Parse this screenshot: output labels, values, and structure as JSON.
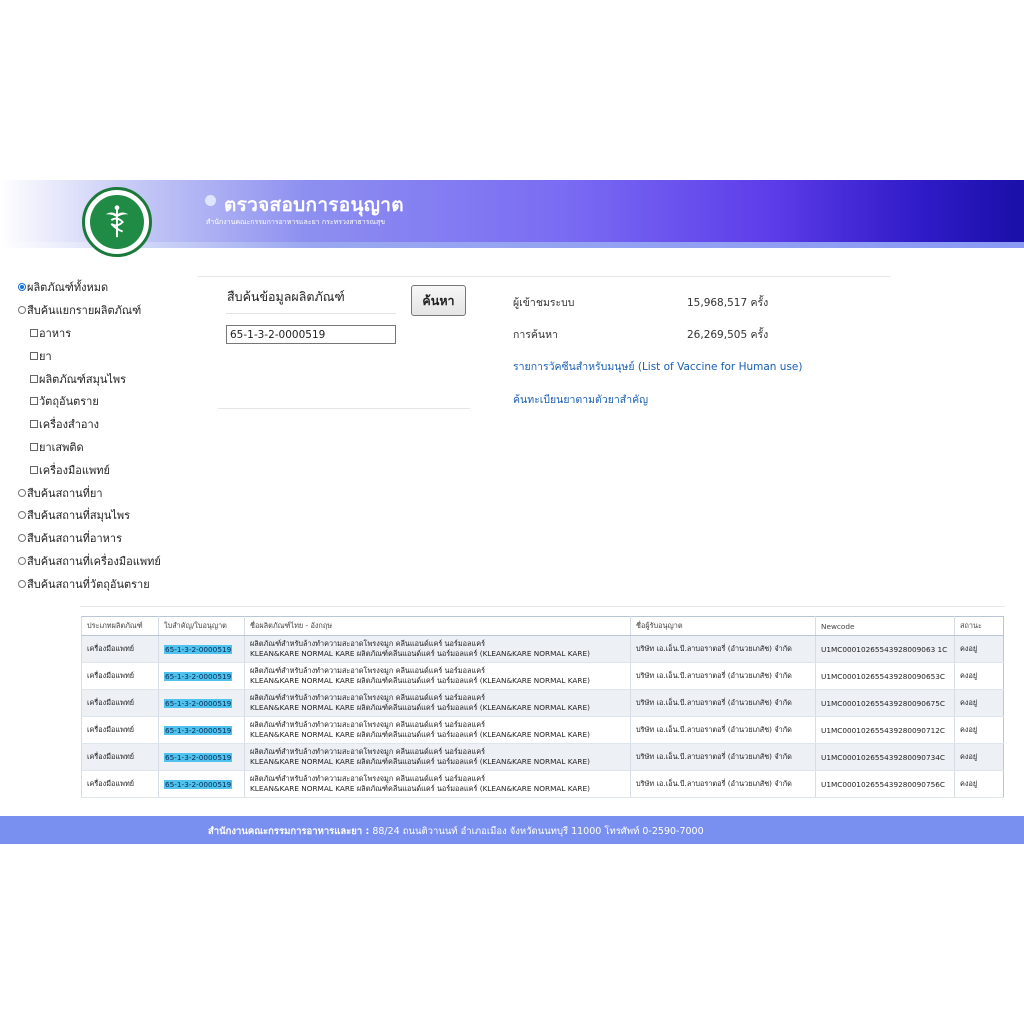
{
  "header": {
    "title": "ตรวจสอบการอนุญาต",
    "subtitle": "สำนักงานคณะกรรมการอาหารและยา กระทรวงสาธารณสุข"
  },
  "menu": {
    "items": [
      {
        "label": "ผลิตภัณฑ์ทั้งหมด",
        "type": "radio",
        "checked": true,
        "sub": false
      },
      {
        "label": "สืบค้นแยกรายผลิตภัณฑ์",
        "type": "radio",
        "checked": false,
        "sub": false
      },
      {
        "label": "อาหาร",
        "type": "checkbox",
        "checked": false,
        "sub": true
      },
      {
        "label": "ยา",
        "type": "checkbox",
        "checked": false,
        "sub": true
      },
      {
        "label": "ผลิตภัณฑ์สมุนไพร",
        "type": "checkbox",
        "checked": false,
        "sub": true
      },
      {
        "label": "วัตถุอันตราย",
        "type": "checkbox",
        "checked": false,
        "sub": true
      },
      {
        "label": "เครื่องสำอาง",
        "type": "checkbox",
        "checked": false,
        "sub": true
      },
      {
        "label": "ยาเสพติด",
        "type": "checkbox",
        "checked": false,
        "sub": true
      },
      {
        "label": "เครื่องมือแพทย์",
        "type": "checkbox",
        "checked": false,
        "sub": true
      },
      {
        "label": "สืบค้นสถานที่ยา",
        "type": "radio",
        "checked": false,
        "sub": false
      },
      {
        "label": "สืบค้นสถานที่สมุนไพร",
        "type": "radio",
        "checked": false,
        "sub": false
      },
      {
        "label": "สืบค้นสถานที่อาหาร",
        "type": "radio",
        "checked": false,
        "sub": false
      },
      {
        "label": "สืบค้นสถานที่เครื่องมือแพทย์",
        "type": "radio",
        "checked": false,
        "sub": false
      },
      {
        "label": "สืบค้นสถานที่วัตถุอันตราย",
        "type": "radio",
        "checked": false,
        "sub": false
      }
    ]
  },
  "search": {
    "label": "สืบค้นข้อมูลผลิตภัณฑ์",
    "value": "65-1-3-2-0000519",
    "button_label": "ค้นหา"
  },
  "stats": {
    "visitors_label": "ผู้เข้าชมระบบ",
    "visitors_value": "15,968,517 ครั้ง",
    "searches_label": "การค้นหา",
    "searches_value": "26,269,505 ครั้ง",
    "vaccine_link": "รายการวัคซีนสำหรับมนุษย์ (List of Vaccine for Human use)",
    "drug_link": "ค้นทะเบียนยาตามตัวยาสำคัญ"
  },
  "table": {
    "headers": [
      "ประเภทผลิตภัณฑ์",
      "ใบสำคัญ/ใบอนุญาต",
      "ชื่อผลิตภัณฑ์ไทย - อังกฤษ",
      "ชื่อผู้รับอนุญาต",
      "Newcode",
      "สถานะ"
    ],
    "rows": [
      {
        "type": "เครื่องมือแพทย์",
        "license": "65-1-3-2-0000519",
        "name_th": "ผลิตภัณฑ์สำหรับล้างทำความสะอาดโพรงจมูก คลีนแอนด์แคร์ นอร์มอลแคร์",
        "name_en": "KLEAN&KARE NORMAL KARE ผลิตภัณฑ์คลีนแอนด์แคร์ นอร์มอลแคร์ (KLEAN&KARE NORMAL KARE)",
        "holder": "บริษัท เอ.เอ็น.บี.ลาบอราตอรี่ (อำนวยเภสัช) จำกัด",
        "newcode": "U1MC00010265543928009063 1C",
        "status": "คงอยู่"
      },
      {
        "type": "เครื่องมือแพทย์",
        "license": "65-1-3-2-0000519",
        "name_th": "ผลิตภัณฑ์สำหรับล้างทำความสะอาดโพรงจมูก คลีนแอนด์แคร์ นอร์มอลแคร์",
        "name_en": "KLEAN&KARE NORMAL KARE ผลิตภัณฑ์คลีนแอนด์แคร์ นอร์มอลแคร์ (KLEAN&KARE NORMAL KARE)",
        "holder": "บริษัท เอ.เอ็น.บี.ลาบอราตอรี่ (อำนวยเภสัช) จำกัด",
        "newcode": "U1MC000102655439280090653C",
        "status": "คงอยู่"
      },
      {
        "type": "เครื่องมือแพทย์",
        "license": "65-1-3-2-0000519",
        "name_th": "ผลิตภัณฑ์สำหรับล้างทำความสะอาดโพรงจมูก คลีนแอนด์แคร์ นอร์มอลแคร์",
        "name_en": "KLEAN&KARE NORMAL KARE ผลิตภัณฑ์คลีนแอนด์แคร์ นอร์มอลแคร์ (KLEAN&KARE NORMAL KARE)",
        "holder": "บริษัท เอ.เอ็น.บี.ลาบอราตอรี่ (อำนวยเภสัช) จำกัด",
        "newcode": "U1MC000102655439280090675C",
        "status": "คงอยู่"
      },
      {
        "type": "เครื่องมือแพทย์",
        "license": "65-1-3-2-0000519",
        "name_th": "ผลิตภัณฑ์สำหรับล้างทำความสะอาดโพรงจมูก คลีนแอนด์แคร์ นอร์มอลแคร์",
        "name_en": "KLEAN&KARE NORMAL KARE ผลิตภัณฑ์คลีนแอนด์แคร์ นอร์มอลแคร์ (KLEAN&KARE NORMAL KARE)",
        "holder": "บริษัท เอ.เอ็น.บี.ลาบอราตอรี่ (อำนวยเภสัช) จำกัด",
        "newcode": "U1MC000102655439280090712C",
        "status": "คงอยู่"
      },
      {
        "type": "เครื่องมือแพทย์",
        "license": "65-1-3-2-0000519",
        "name_th": "ผลิตภัณฑ์สำหรับล้างทำความสะอาดโพรงจมูก คลีนแอนด์แคร์ นอร์มอลแคร์",
        "name_en": "KLEAN&KARE NORMAL KARE ผลิตภัณฑ์คลีนแอนด์แคร์ นอร์มอลแคร์ (KLEAN&KARE NORMAL KARE)",
        "holder": "บริษัท เอ.เอ็น.บี.ลาบอราตอรี่ (อำนวยเภสัช) จำกัด",
        "newcode": "U1MC000102655439280090734C",
        "status": "คงอยู่"
      },
      {
        "type": "เครื่องมือแพทย์",
        "license": "65-1-3-2-0000519",
        "name_th": "ผลิตภัณฑ์สำหรับล้างทำความสะอาดโพรงจมูก คลีนแอนด์แคร์ นอร์มอลแคร์",
        "name_en": "KLEAN&KARE NORMAL KARE ผลิตภัณฑ์คลีนแอนด์แคร์ นอร์มอลแคร์ (KLEAN&KARE NORMAL KARE)",
        "holder": "บริษัท เอ.เอ็น.บี.ลาบอราตอรี่ (อำนวยเภสัช) จำกัด",
        "newcode": "U1MC000102655439280090756C",
        "status": "คงอยู่"
      }
    ]
  },
  "footer": {
    "org": "สำนักงานคณะกรรมการอาหารและยา :",
    "address": " 88/24 ถนนติวานนท์ อำเภอเมือง จังหวัดนนทบุรี 11000 โทรศัพท์ 0-2590-7000"
  },
  "icons": {
    "logo": "ministry-of-public-health-seal",
    "title_bullet": "circle-bullet"
  },
  "colors": {
    "banner_end": "#1a0fa8",
    "footer": "#7a90f0",
    "link": "#1a5fb4",
    "highlight": "#4fc3ee"
  }
}
